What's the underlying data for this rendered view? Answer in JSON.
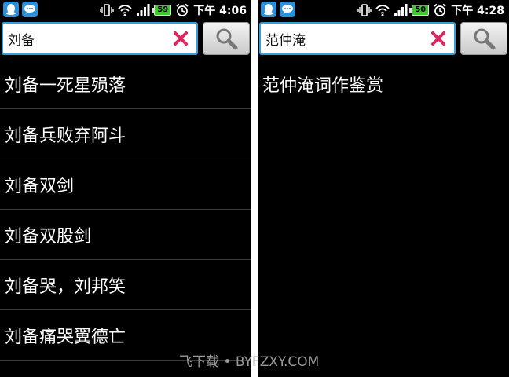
{
  "screens": [
    {
      "status": {
        "time": "下午 4:06",
        "battery": "59"
      },
      "search": {
        "query": "刘备"
      },
      "results": [
        "刘备一死星殒落",
        "刘备兵败弃阿斗",
        "刘备双剑",
        "刘备双股剑",
        "刘备哭，刘邦笑",
        "刘备痛哭翼德亡"
      ]
    },
    {
      "status": {
        "time": "下午 4:28",
        "battery": "50"
      },
      "search": {
        "query": "范仲淹"
      },
      "results": [
        "范仲淹词作鉴赏"
      ]
    }
  ],
  "watermark": "飞下载 • BYFZXY.COM",
  "colors": {
    "accent": "#2fa1e0",
    "clear": "#e0245e",
    "battery": "#3dcb2c",
    "background": "#000000"
  }
}
